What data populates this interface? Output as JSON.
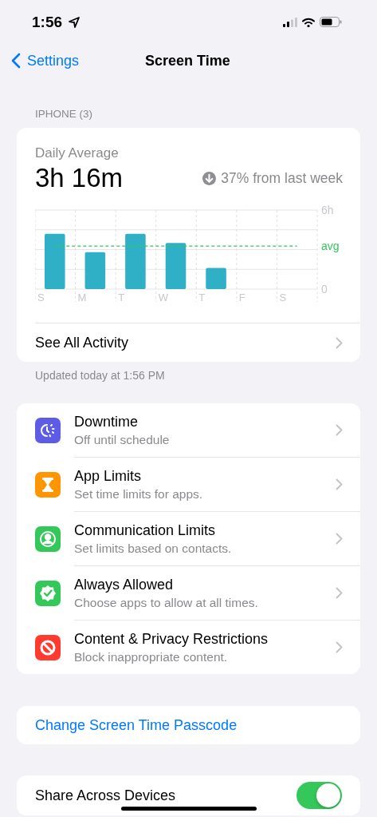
{
  "status_bar": {
    "time": "1:56"
  },
  "nav": {
    "back": "Settings",
    "title": "Screen Time"
  },
  "section_header": "IPHONE (3)",
  "summary": {
    "label": "Daily Average",
    "value": "3h 16m",
    "change": "37% from last week",
    "chart_data": {
      "type": "bar",
      "categories": [
        "S",
        "M",
        "T",
        "W",
        "T",
        "F",
        "S"
      ],
      "series": [
        {
          "color": "#30b0c7",
          "values": [
            4.2,
            2.8,
            4.2,
            3.5,
            1.6,
            null,
            null
          ]
        },
        {
          "name": "avg",
          "type": "line",
          "line_style": "dashed",
          "color": "#34c759",
          "values": [
            3.27,
            3.27,
            3.27,
            3.27,
            3.27,
            3.27,
            3.27
          ]
        }
      ],
      "yticks": [
        0,
        {
          "value": 6,
          "label": "6h"
        }
      ],
      "ylim": [
        0,
        6
      ]
    },
    "link": "See All Activity"
  },
  "updated": "Updated today at 1:56 PM",
  "settings": [
    {
      "kind": "downtime",
      "title": "Downtime",
      "subtitle": "Off until schedule"
    },
    {
      "kind": "app_limits",
      "title": "App Limits",
      "subtitle": "Set time limits for apps."
    },
    {
      "kind": "communication",
      "title": "Communication Limits",
      "subtitle": "Set limits based on contacts."
    },
    {
      "kind": "always_allowed",
      "title": "Always Allowed",
      "subtitle": "Choose apps to allow at all times."
    },
    {
      "kind": "content_privacy",
      "title": "Content & Privacy Restrictions",
      "subtitle": "Block inappropriate content."
    }
  ],
  "passcode_link": "Change Screen Time Passcode",
  "share": {
    "label": "Share Across Devices",
    "on": true
  }
}
